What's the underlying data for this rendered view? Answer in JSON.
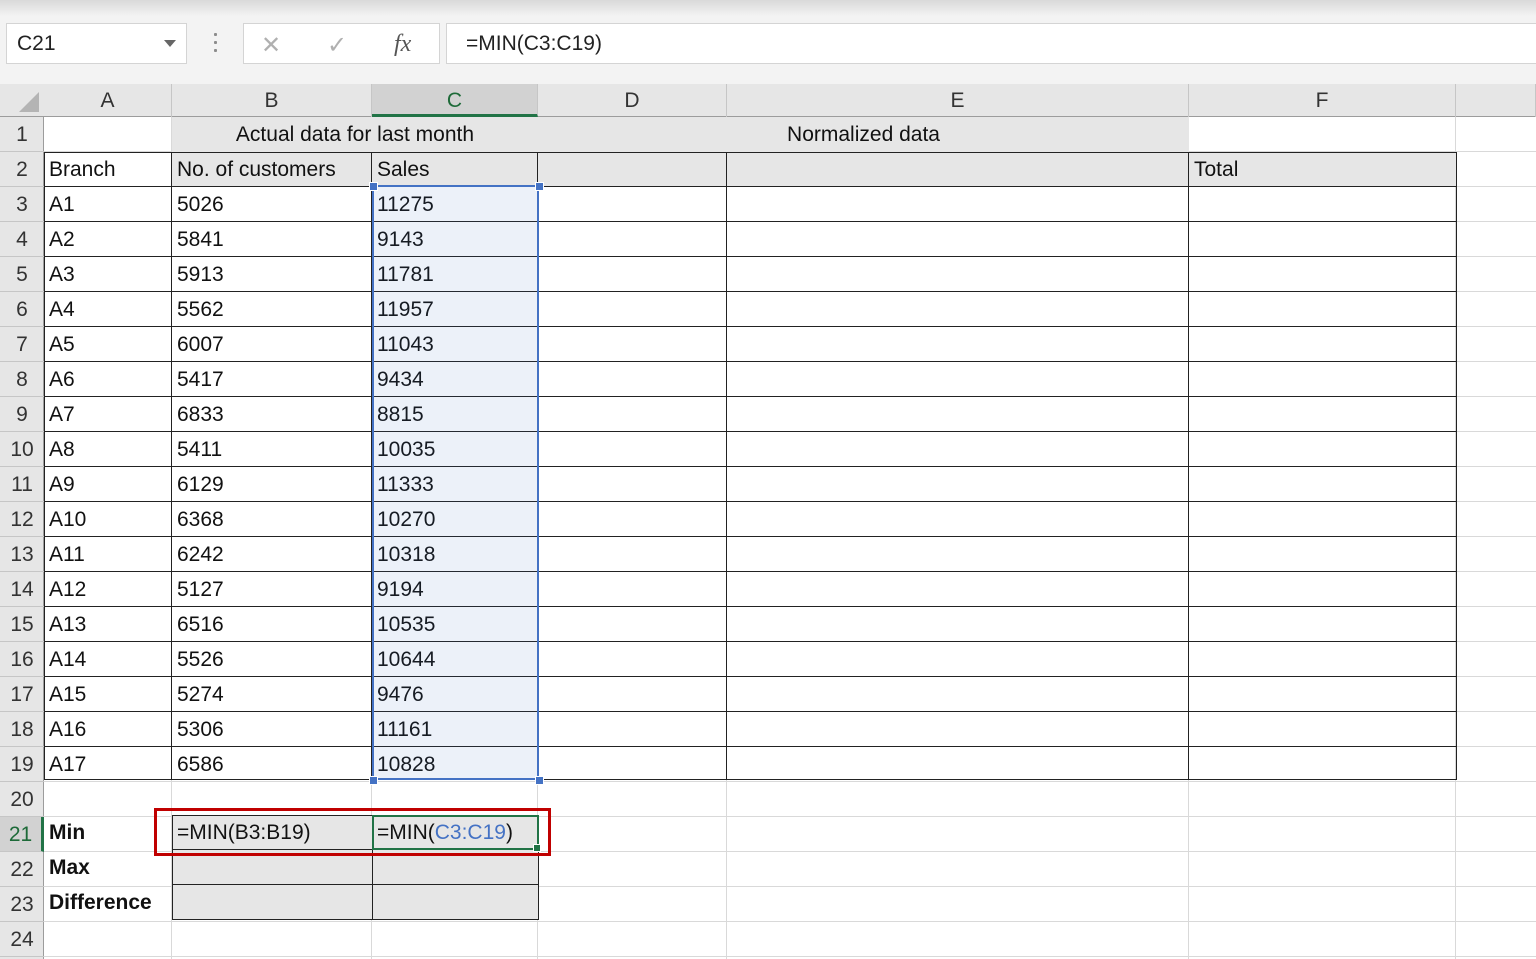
{
  "formula_bar": {
    "name_box": "C21",
    "cancel_icon": "cancel-x-icon",
    "enter_icon": "enter-check-icon",
    "fx_label": "fx",
    "formula": "=MIN(C3:C19)"
  },
  "columns": [
    "A",
    "B",
    "C",
    "D",
    "E",
    "F"
  ],
  "selected_column": "C",
  "selected_row": "21",
  "rows": [
    "1",
    "2",
    "3",
    "4",
    "5",
    "6",
    "7",
    "8",
    "9",
    "10",
    "11",
    "12",
    "13",
    "14",
    "15",
    "16",
    "17",
    "18",
    "19",
    "20",
    "21",
    "22",
    "23",
    "24"
  ],
  "headers": {
    "actual": "Actual data for last month",
    "normalized": "Normalized data",
    "branch": "Branch",
    "customers": "No. of customers",
    "sales": "Sales",
    "total": "Total"
  },
  "data": [
    {
      "branch": "A1",
      "customers": "5026",
      "sales": "11275"
    },
    {
      "branch": "A2",
      "customers": "5841",
      "sales": "9143"
    },
    {
      "branch": "A3",
      "customers": "5913",
      "sales": "11781"
    },
    {
      "branch": "A4",
      "customers": "5562",
      "sales": "11957"
    },
    {
      "branch": "A5",
      "customers": "6007",
      "sales": "11043"
    },
    {
      "branch": "A6",
      "customers": "5417",
      "sales": "9434"
    },
    {
      "branch": "A7",
      "customers": "6833",
      "sales": "8815"
    },
    {
      "branch": "A8",
      "customers": "5411",
      "sales": "10035"
    },
    {
      "branch": "A9",
      "customers": "6129",
      "sales": "11333"
    },
    {
      "branch": "A10",
      "customers": "6368",
      "sales": "10270"
    },
    {
      "branch": "A11",
      "customers": "6242",
      "sales": "10318"
    },
    {
      "branch": "A12",
      "customers": "5127",
      "sales": "9194"
    },
    {
      "branch": "A13",
      "customers": "6516",
      "sales": "10535"
    },
    {
      "branch": "A14",
      "customers": "5526",
      "sales": "10644"
    },
    {
      "branch": "A15",
      "customers": "5274",
      "sales": "9476"
    },
    {
      "branch": "A16",
      "customers": "5306",
      "sales": "11161"
    },
    {
      "branch": "A17",
      "customers": "6586",
      "sales": "10828"
    }
  ],
  "summary": {
    "min_label": "Min",
    "max_label": "Max",
    "diff_label": "Difference",
    "min_b_formula": "=MIN(B3:B19)",
    "min_c_prefix": "=MIN(",
    "min_c_ref": "C3:C19",
    "min_c_suffix": ")"
  },
  "colors": {
    "selection": "#4472c4",
    "active_cell": "#217346",
    "highlight_box": "#c00000",
    "header_fill": "#e6e6e6"
  }
}
